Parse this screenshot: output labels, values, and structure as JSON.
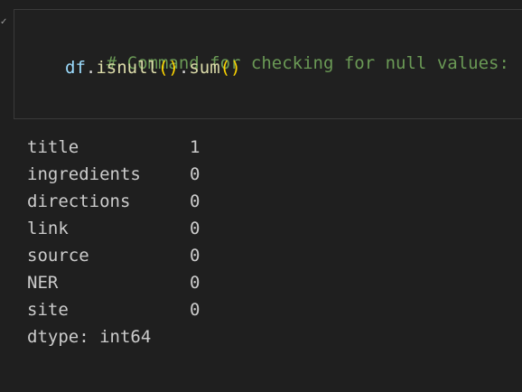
{
  "gutter": {
    "status_glyph": "✓"
  },
  "code_cell": {
    "comment": "# Command for checking for null values:",
    "code_var": "df",
    "code_dot1": ".",
    "code_func1": "isnull",
    "code_parens1": "()",
    "code_dot2": ".",
    "code_func2": "sum",
    "code_parens2": "()"
  },
  "output": {
    "rows": [
      {
        "name": "title",
        "value": "1"
      },
      {
        "name": "ingredients",
        "value": "0"
      },
      {
        "name": "directions",
        "value": "0"
      },
      {
        "name": "link",
        "value": "0"
      },
      {
        "name": "source",
        "value": "0"
      },
      {
        "name": "NER",
        "value": "0"
      },
      {
        "name": "site",
        "value": "0"
      }
    ],
    "dtype": "dtype: int64"
  }
}
